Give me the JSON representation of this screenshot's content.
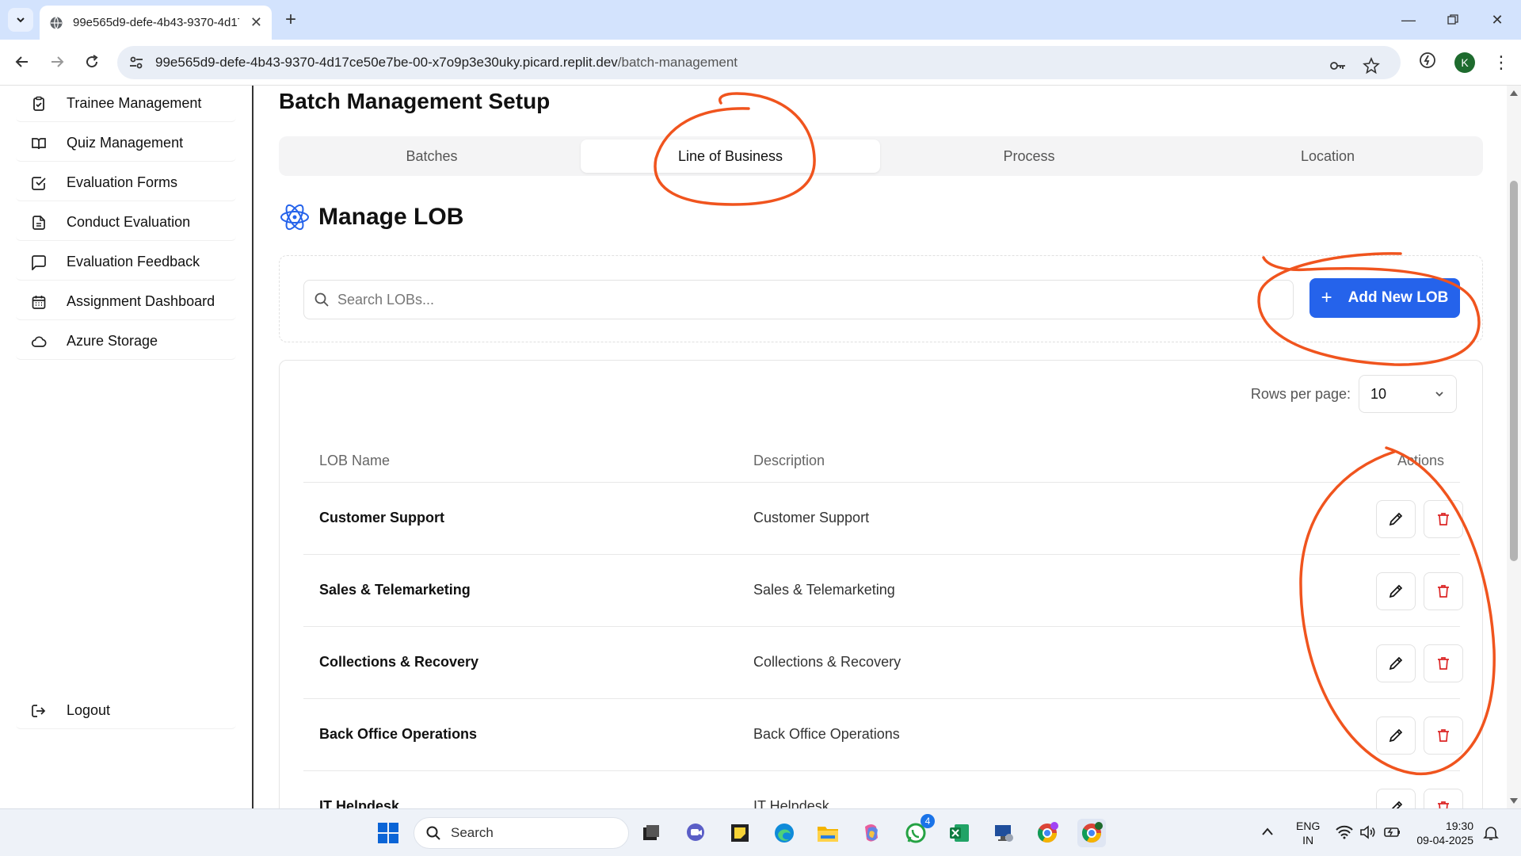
{
  "browser": {
    "tab_title": "99e565d9-defe-4b43-9370-4d17ce50e7be-00-x7o9p3e30uky.picard.replit.dev",
    "url_host": "99e565d9-defe-4b43-9370-4d17ce50e7be-00-x7o9p3e30uky.picard.replit.dev",
    "url_path": "/batch-management",
    "profile_initial": "K"
  },
  "sidebar": {
    "items": [
      {
        "label": "Trainee Management",
        "icon": "clipboard-check-icon"
      },
      {
        "label": "Quiz Management",
        "icon": "book-open-icon"
      },
      {
        "label": "Evaluation Forms",
        "icon": "check-square-icon"
      },
      {
        "label": "Conduct Evaluation",
        "icon": "file-text-icon"
      },
      {
        "label": "Evaluation Feedback",
        "icon": "message-square-icon"
      },
      {
        "label": "Assignment Dashboard",
        "icon": "calendar-icon"
      },
      {
        "label": "Azure Storage",
        "icon": "cloud-icon"
      }
    ],
    "logout_label": "Logout"
  },
  "main": {
    "page_title": "Batch Management Setup",
    "tabs": [
      {
        "label": "Batches",
        "active": false
      },
      {
        "label": "Line of Business",
        "active": true
      },
      {
        "label": "Process",
        "active": false
      },
      {
        "label": "Location",
        "active": false
      }
    ],
    "section_title": "Manage LOB",
    "search_placeholder": "Search LOBs...",
    "add_button_label": "Add New LOB",
    "rows_per_page_label": "Rows per page:",
    "rows_per_page_value": "10",
    "columns": {
      "name": "LOB Name",
      "description": "Description",
      "actions": "Actions"
    },
    "rows": [
      {
        "name": "Customer Support",
        "description": "Customer Support"
      },
      {
        "name": "Sales & Telemarketing",
        "description": "Sales & Telemarketing"
      },
      {
        "name": "Collections & Recovery",
        "description": "Collections & Recovery"
      },
      {
        "name": "Back Office Operations",
        "description": "Back Office Operations"
      },
      {
        "name": "IT Helpdesk",
        "description": "IT Helpdesk"
      }
    ]
  },
  "taskbar": {
    "search_label": "Search",
    "whatsapp_badge": "4",
    "lang_line1": "ENG",
    "lang_line2": "IN",
    "time": "19:30",
    "date": "09-04-2025"
  },
  "colors": {
    "accent": "#2563eb",
    "danger": "#dc2626",
    "annotation": "#f0541e"
  }
}
